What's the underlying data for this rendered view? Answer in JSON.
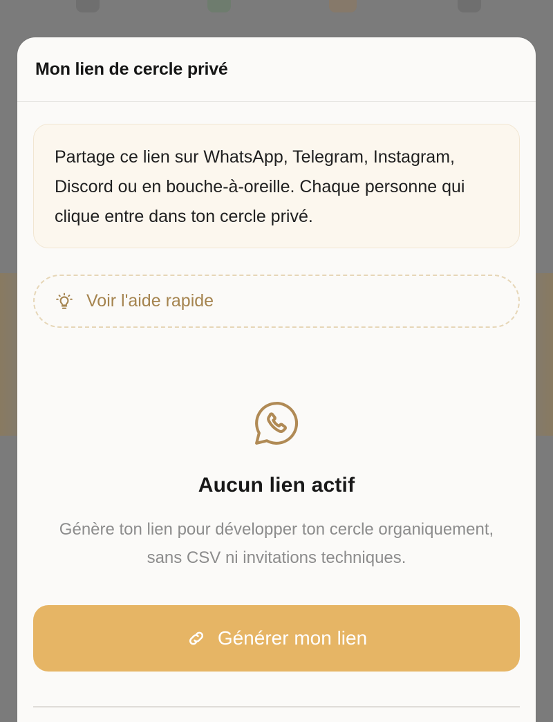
{
  "modal": {
    "title": "Mon lien de cercle privé"
  },
  "info": {
    "text": "Partage ce lien sur WhatsApp, Telegram, Instagram, Discord ou en bouche-à-oreille. Chaque personne qui clique entre dans ton cercle privé."
  },
  "help": {
    "label": "Voir l'aide rapide",
    "icon": "lightbulb-icon"
  },
  "empty_state": {
    "icon": "whatsapp-icon",
    "title": "Aucun lien actif",
    "description": "Génère ton lien pour développer ton cercle organiquement, sans CSV ni invitations techniques."
  },
  "primary_action": {
    "label": "Générer mon lien",
    "icon": "link-icon"
  },
  "colors": {
    "accent": "#e6b565",
    "accent_text": "#a5844f",
    "info_bg": "#fcf7ee",
    "sheet_bg": "#fbfaf8",
    "overlay": "#7b7b7b"
  }
}
